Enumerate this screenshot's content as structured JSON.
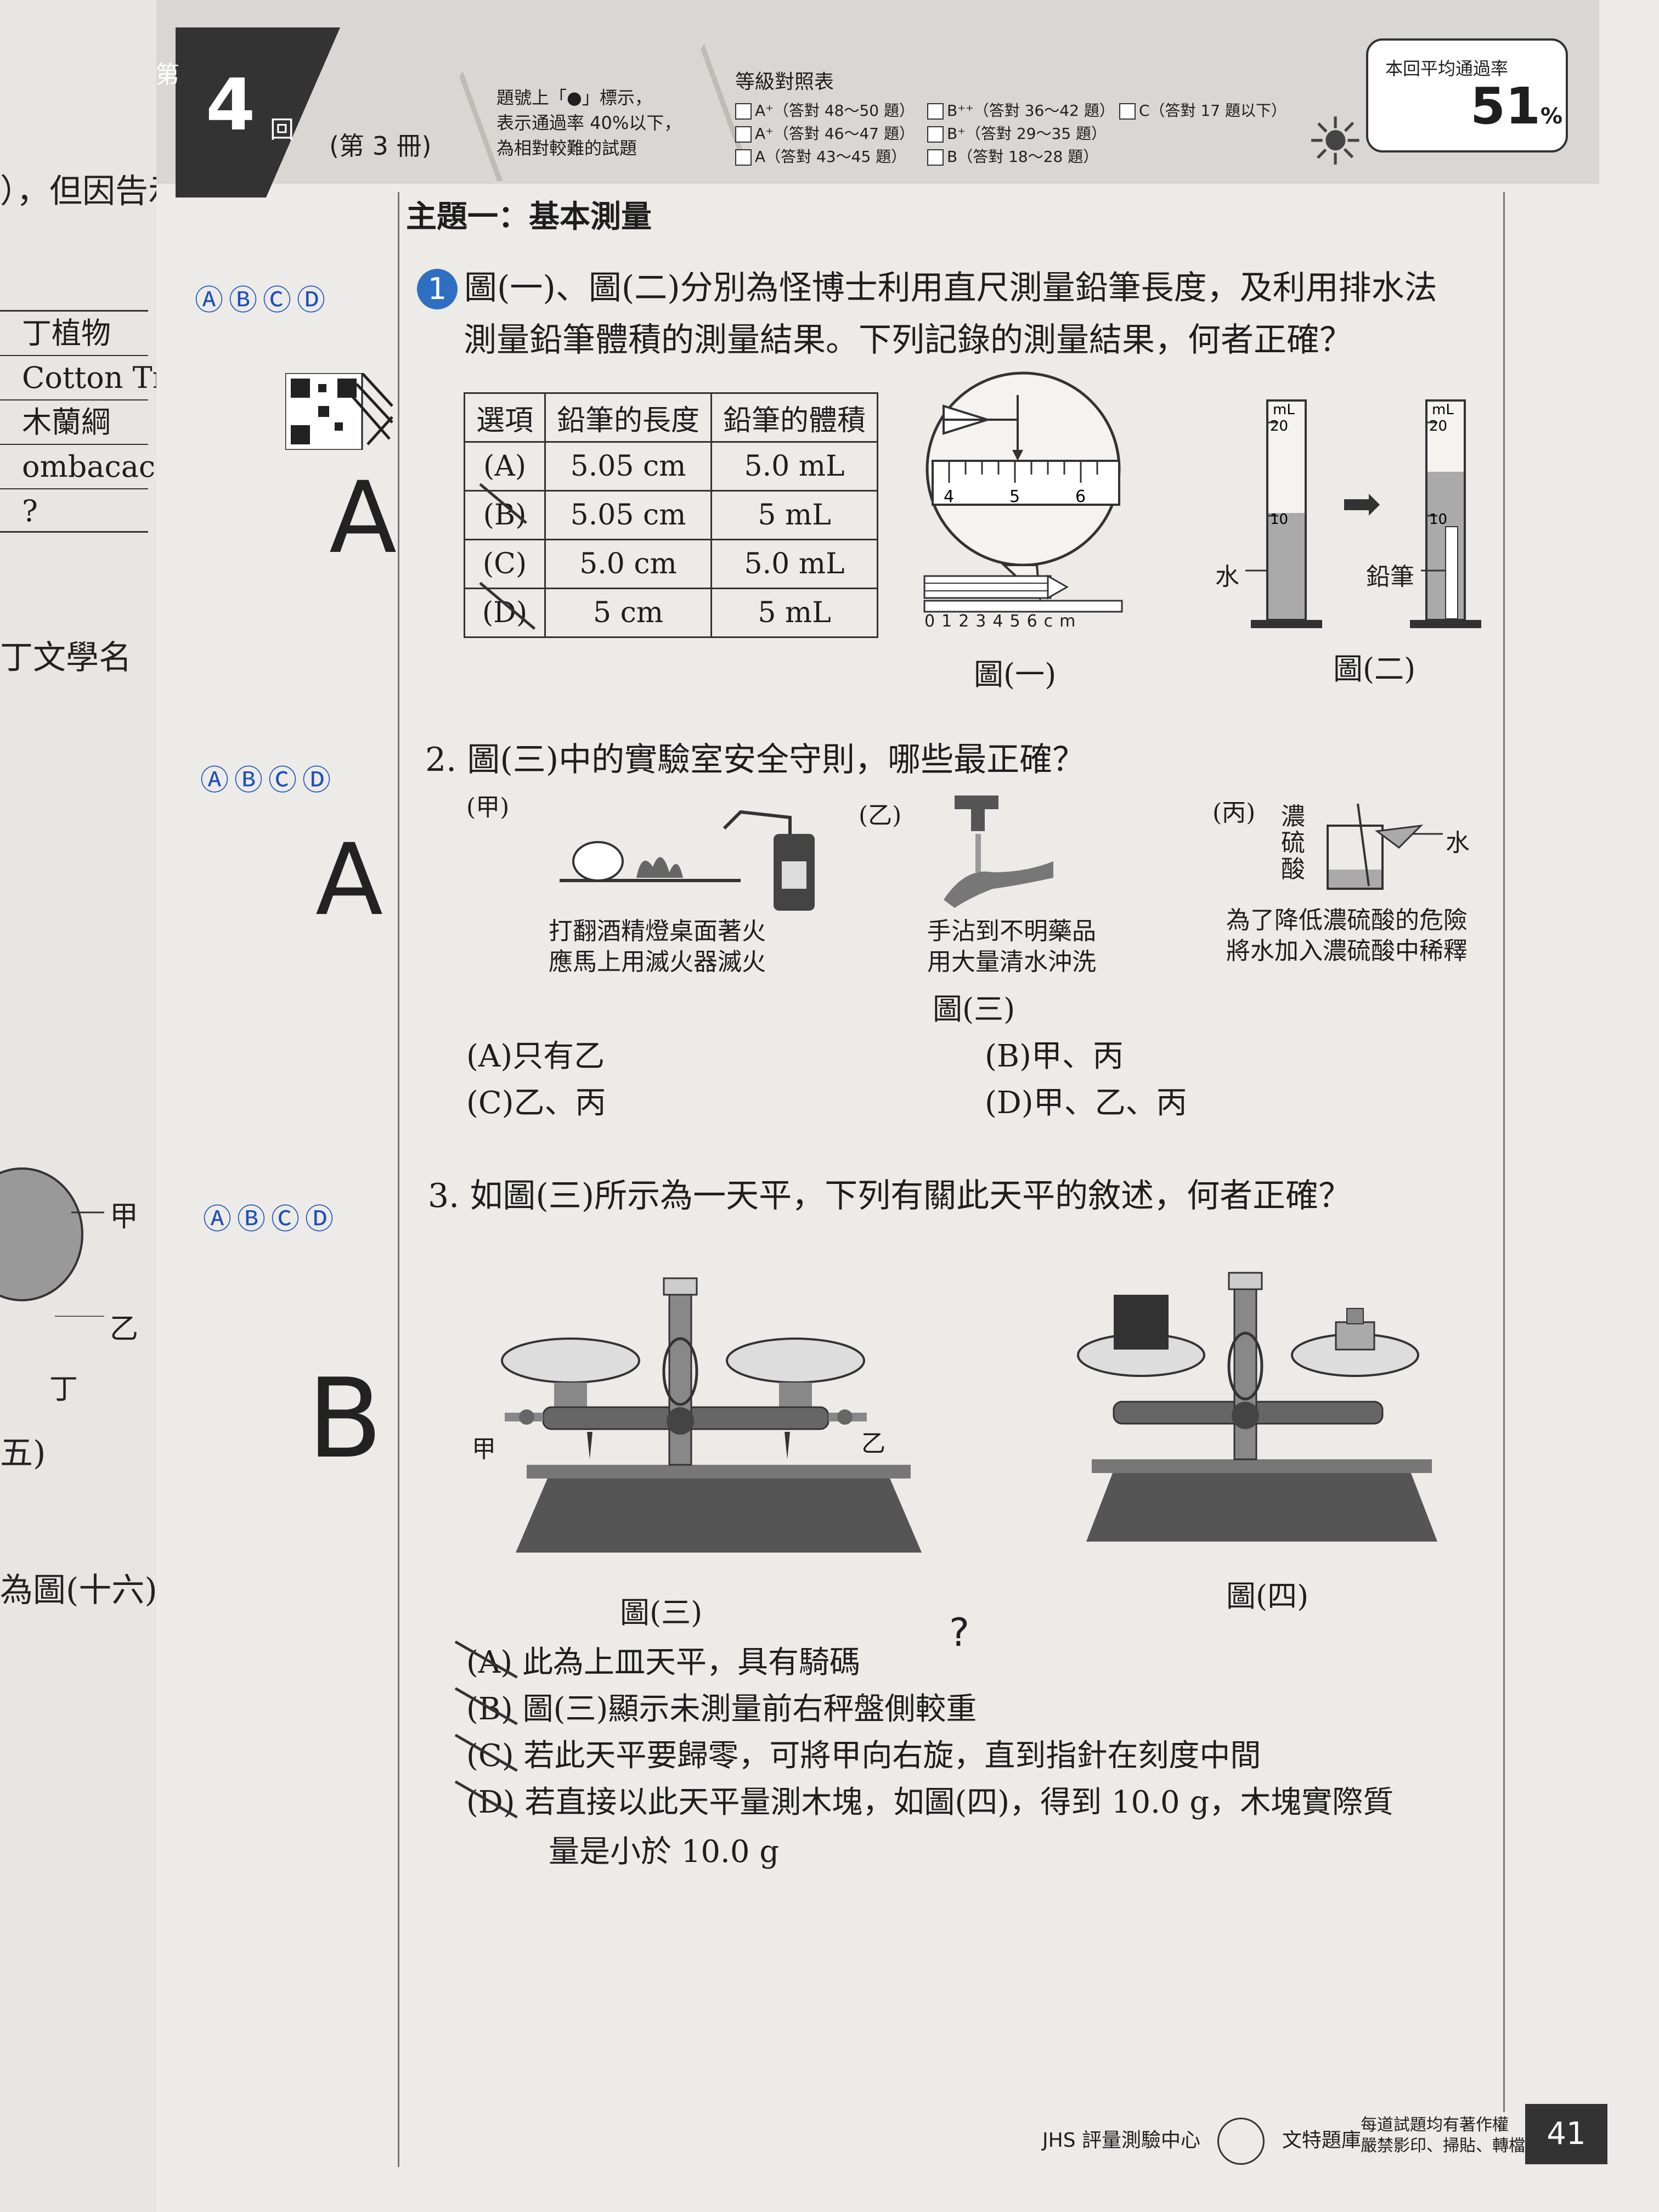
{
  "left_page": {
    "fragments": [
      "），但因告示",
      "丁文學名",
      "為圖(十六)",
      "五)",
      "甲",
      "乙",
      "丁"
    ],
    "table_rows": [
      "丁植物",
      "Cotton Tree",
      "木蘭綱",
      "ombacaceae",
      "?"
    ]
  },
  "header": {
    "di": "第",
    "round_number": "4",
    "round_suffix": "回",
    "volume": "(第 3 冊)",
    "hint_lines": [
      "題號上「●」標示，",
      "表示通過率 40%以下，",
      "為相對較難的試題"
    ],
    "grade_table_title": "等級對照表",
    "grades": [
      [
        "A⁺（答對 48～50 題）",
        "B⁺⁺（答對 36～42 題）",
        "C（答對 17 題以下）"
      ],
      [
        "A⁺（答對 46～47 題）",
        "B⁺（答對 29～35 題）",
        ""
      ],
      [
        "A（答對 43～45 題）",
        "B（答對 18～28 題）",
        ""
      ]
    ],
    "pass_rate_label": "本回平均通過率",
    "pass_rate": "51",
    "pass_rate_unit": "%"
  },
  "topic": "主題一：基本測量",
  "answer_choices": "ⒶⒷⒸⒹ",
  "q1": {
    "number": "1",
    "text_line1": "圖(一)、圖(二)分別為怪博士利用直尺測量鉛筆長度，及利用排水法",
    "text_line2": "測量鉛筆體積的測量結果。下列記錄的測量結果，何者正確？",
    "handwritten_answer": "A",
    "table": {
      "headers": [
        "選項",
        "鉛筆的長度",
        "鉛筆的體積"
      ],
      "rows": [
        [
          "(A)",
          "5.05 cm",
          "5.0 mL"
        ],
        [
          "(B)",
          "5.05 cm",
          "5 mL"
        ],
        [
          "(C)",
          "5.0 cm",
          "5.0 mL"
        ],
        [
          "(D)",
          "5 cm",
          "5 mL"
        ]
      ]
    },
    "fig1_caption": "圖(一)",
    "fig2_caption": "圖(二)",
    "ruler_ticks": [
      "0",
      "1",
      "2",
      "3",
      "4",
      "5",
      "6cm"
    ],
    "zoom_ticks": [
      "4",
      "5",
      "6"
    ],
    "cylinder_labels": {
      "unit": "mL",
      "top": "20",
      "mid": "10",
      "water": "水",
      "pencil": "鉛筆"
    }
  },
  "q2": {
    "text": "2. 圖(三)中的實驗室安全守則，哪些最正確？",
    "handwritten_answer": "A",
    "labels": {
      "a": "(甲)",
      "b": "(乙)",
      "c": "(丙)"
    },
    "desc_a": [
      "打翻酒精燈桌面著火",
      "應馬上用滅火器滅火"
    ],
    "desc_b": [
      "手沾到不明藥品",
      "用大量清水沖洗"
    ],
    "desc_c": [
      "為了降低濃硫酸的危險",
      "將水加入濃硫酸中稀釋"
    ],
    "acid_label": [
      "濃",
      "硫",
      "酸"
    ],
    "water_label": "水",
    "caption": "圖(三)",
    "options": [
      "(A)只有乙",
      "(B)甲、丙",
      "(C)乙、丙",
      "(D)甲、乙、丙"
    ]
  },
  "q3": {
    "text": "3. 如圖(三)所示為一天平，下列有關此天平的敘述，何者正確？",
    "handwritten_answer": "B",
    "label_jia": "甲",
    "label_yi": "乙",
    "fig3_caption": "圖(三)",
    "fig4_caption": "圖(四)",
    "options": [
      "(A) 此為上皿天平，具有騎碼",
      "(B) 圖(三)顯示未測量前右秤盤側較重",
      "(C) 若此天平要歸零，可將甲向右旋，直到指針在刻度中間",
      "(D) 若直接以此天平量測木塊，如圖(四)，得到 10.0 g，木塊實際質"
    ],
    "option_d_cont": "量是小於 10.0 g",
    "question_mark": "?"
  },
  "footer": {
    "logo": "JHS 評量測驗中心",
    "brand": "文特題庫",
    "copyright": [
      "每道試題均有著作權",
      "嚴禁影印、掃貼、轉檔上網營利"
    ],
    "page_number": "41"
  }
}
